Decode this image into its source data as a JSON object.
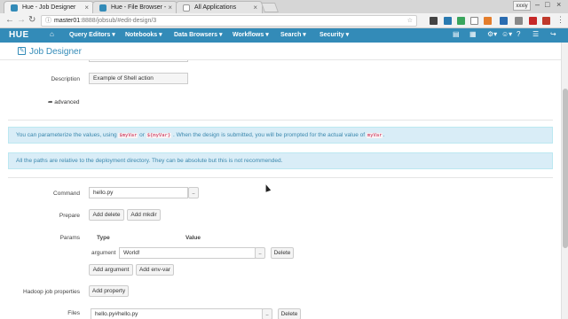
{
  "browser": {
    "tabs": [
      {
        "title": "Hue - Job Designer",
        "active": true
      },
      {
        "title": "Hue - File Browser -",
        "active": false
      },
      {
        "title": "All Applications",
        "active": false
      }
    ],
    "user": "xxxiy",
    "url_host": "master01",
    "url_rest": ":8888/jobsub/#edit-design/3"
  },
  "navbar": {
    "logo": "HUE",
    "items": [
      "Query Editors",
      "Notebooks",
      "Data Browsers",
      "Workflows",
      "Search",
      "Security"
    ]
  },
  "page": {
    "title": "Job Designer"
  },
  "form": {
    "description_label": "Description",
    "description_value": "Example of Shell action",
    "advanced_label": "advanced",
    "info1_pre": "You can parameterize the values, using",
    "info1_code1": "$myVar",
    "info1_or": "or",
    "info1_code2": "${myVar}",
    "info1_mid": ". When the design is submitted, you will be prompted for the actual value of",
    "info1_code3": "myVar",
    "info1_end": ".",
    "info2": "All the paths are relative to the deployment directory. They can be absolute but this is not recommended.",
    "command_label": "Command",
    "command_value": "hello.py",
    "browse_label": "..",
    "prepare_label": "Prepare",
    "add_delete_label": "Add delete",
    "add_mkdir_label": "Add mkdir",
    "params_label": "Params",
    "col_type": "Type",
    "col_value": "Value",
    "param_type": "argument",
    "param_value": "World!",
    "delete_label": "Delete",
    "add_argument_label": "Add argument",
    "add_envvar_label": "Add env-var",
    "hadoop_label": "Hadoop job properties",
    "add_property_label": "Add property",
    "files_label": "Files",
    "files_value": "hello.py#hello.py"
  }
}
